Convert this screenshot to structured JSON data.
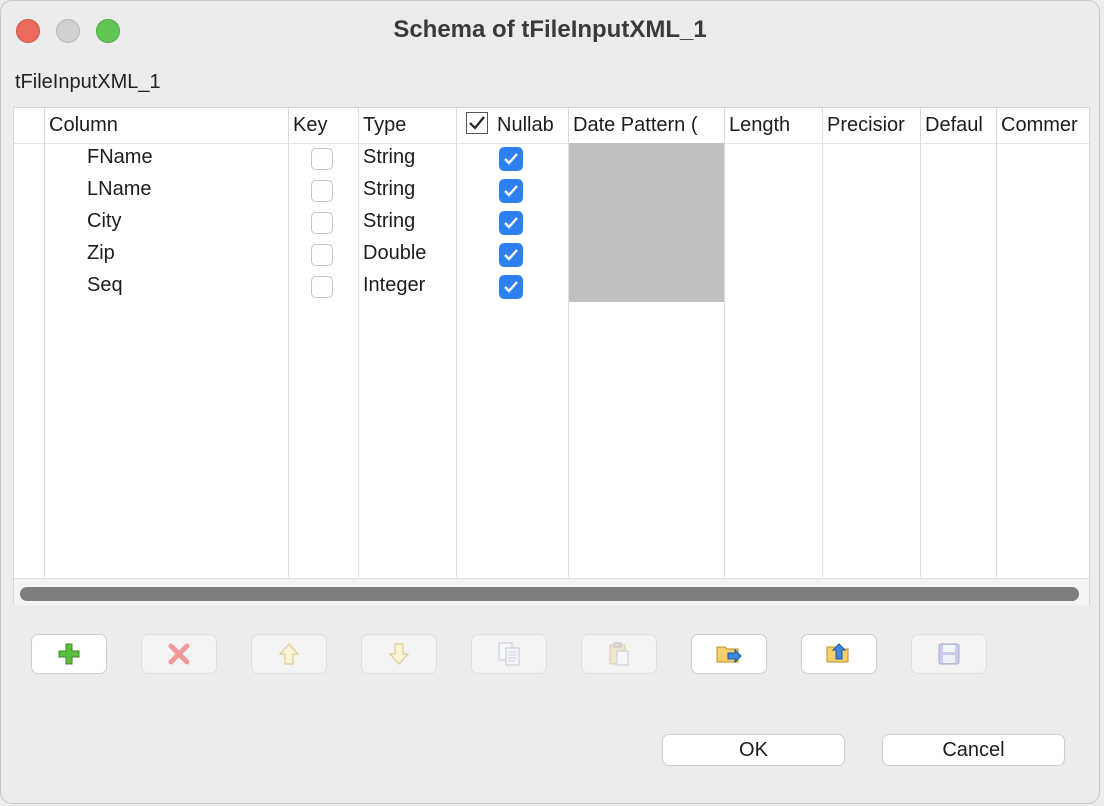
{
  "window": {
    "title": "Schema of tFileInputXML_1",
    "subtitle": "tFileInputXML_1"
  },
  "table": {
    "headers": {
      "column": "Column",
      "key": "Key",
      "type": "Type",
      "nullable": "Nullab",
      "date_pattern": "Date Pattern (",
      "length": "Length",
      "precision": "Precisior",
      "default": "Defaul",
      "comment": "Commer"
    },
    "rows": [
      {
        "column": "FName",
        "key": false,
        "type": "String",
        "nullable": true
      },
      {
        "column": "LName",
        "key": false,
        "type": "String",
        "nullable": true
      },
      {
        "column": "City",
        "key": false,
        "type": "String",
        "nullable": true
      },
      {
        "column": "Zip",
        "key": false,
        "type": "Double",
        "nullable": true
      },
      {
        "column": "Seq",
        "key": false,
        "type": "Integer",
        "nullable": true
      }
    ]
  },
  "toolbar": [
    {
      "icon": "add-icon",
      "enabled": true
    },
    {
      "icon": "remove-icon",
      "enabled": false
    },
    {
      "icon": "move-up-icon",
      "enabled": false
    },
    {
      "icon": "move-down-icon",
      "enabled": false
    },
    {
      "icon": "copy-icon",
      "enabled": false
    },
    {
      "icon": "paste-icon",
      "enabled": false
    },
    {
      "icon": "import-icon",
      "enabled": true
    },
    {
      "icon": "export-icon",
      "enabled": true
    },
    {
      "icon": "save-icon",
      "enabled": false
    }
  ],
  "buttons": {
    "ok": "OK",
    "cancel": "Cancel"
  },
  "colors": {
    "checkbox_accent": "#2d7ff2",
    "add_green": "#4caf3a",
    "remove_red": "#f08080"
  }
}
